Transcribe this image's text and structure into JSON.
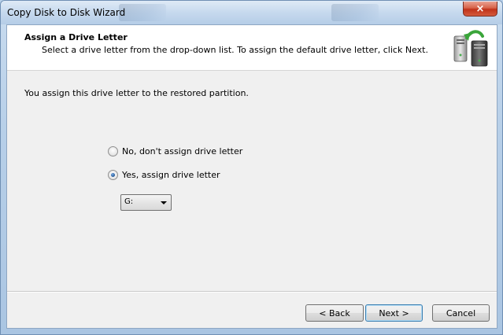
{
  "window": {
    "title": "Copy Disk to Disk Wizard",
    "close_glyph": "×"
  },
  "header": {
    "title": "Assign a Drive Letter",
    "subtitle": "Select a drive letter from the drop-down list. To assign the default drive letter, click Next.",
    "icon": "computers-copy-icon"
  },
  "body": {
    "description": "You assign this drive letter to the restored partition.",
    "options": [
      {
        "label": "No, don't assign drive letter",
        "checked": false
      },
      {
        "label": "Yes, assign drive letter",
        "checked": true
      }
    ],
    "drive_letter": "G:"
  },
  "buttons": {
    "back": "< Back",
    "next": "Next >",
    "cancel": "Cancel"
  },
  "colors": {
    "accent": "#3c7fb1",
    "close": "#c0321a"
  }
}
